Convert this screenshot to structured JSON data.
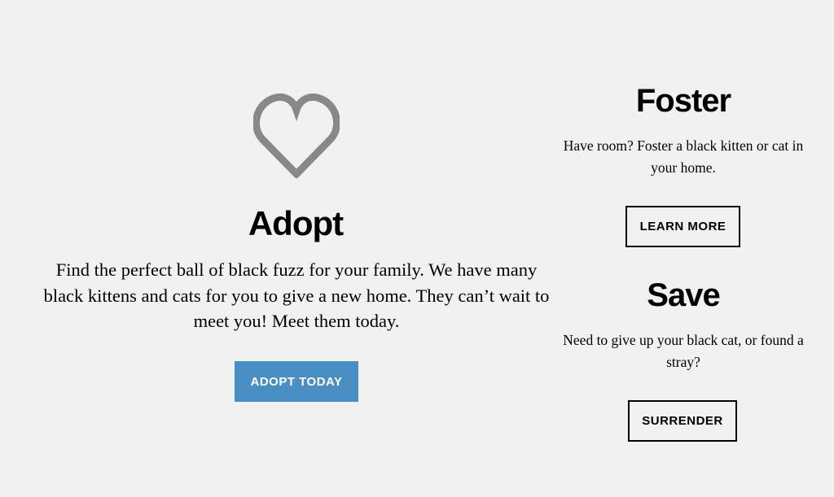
{
  "adopt": {
    "icon": "heart-outline-icon",
    "title": "Adopt",
    "text": "Find the perfect ball of black fuzz for your family. We have many black kittens and cats for you to give a new home. They can’t wait to meet you! Meet them today.",
    "button_label": "ADOPT TODAY"
  },
  "foster": {
    "title": "Foster",
    "text": "Have room? Foster a black kitten or cat in your home.",
    "button_label": "LEARN MORE"
  },
  "save": {
    "title": "Save",
    "text": "Need to give up your black cat, or found a stray?",
    "button_label": "SURRENDER"
  },
  "colors": {
    "background": "#f1f1f1",
    "accent_button": "#4a8fc4",
    "icon": "#888888",
    "text": "#000000"
  }
}
